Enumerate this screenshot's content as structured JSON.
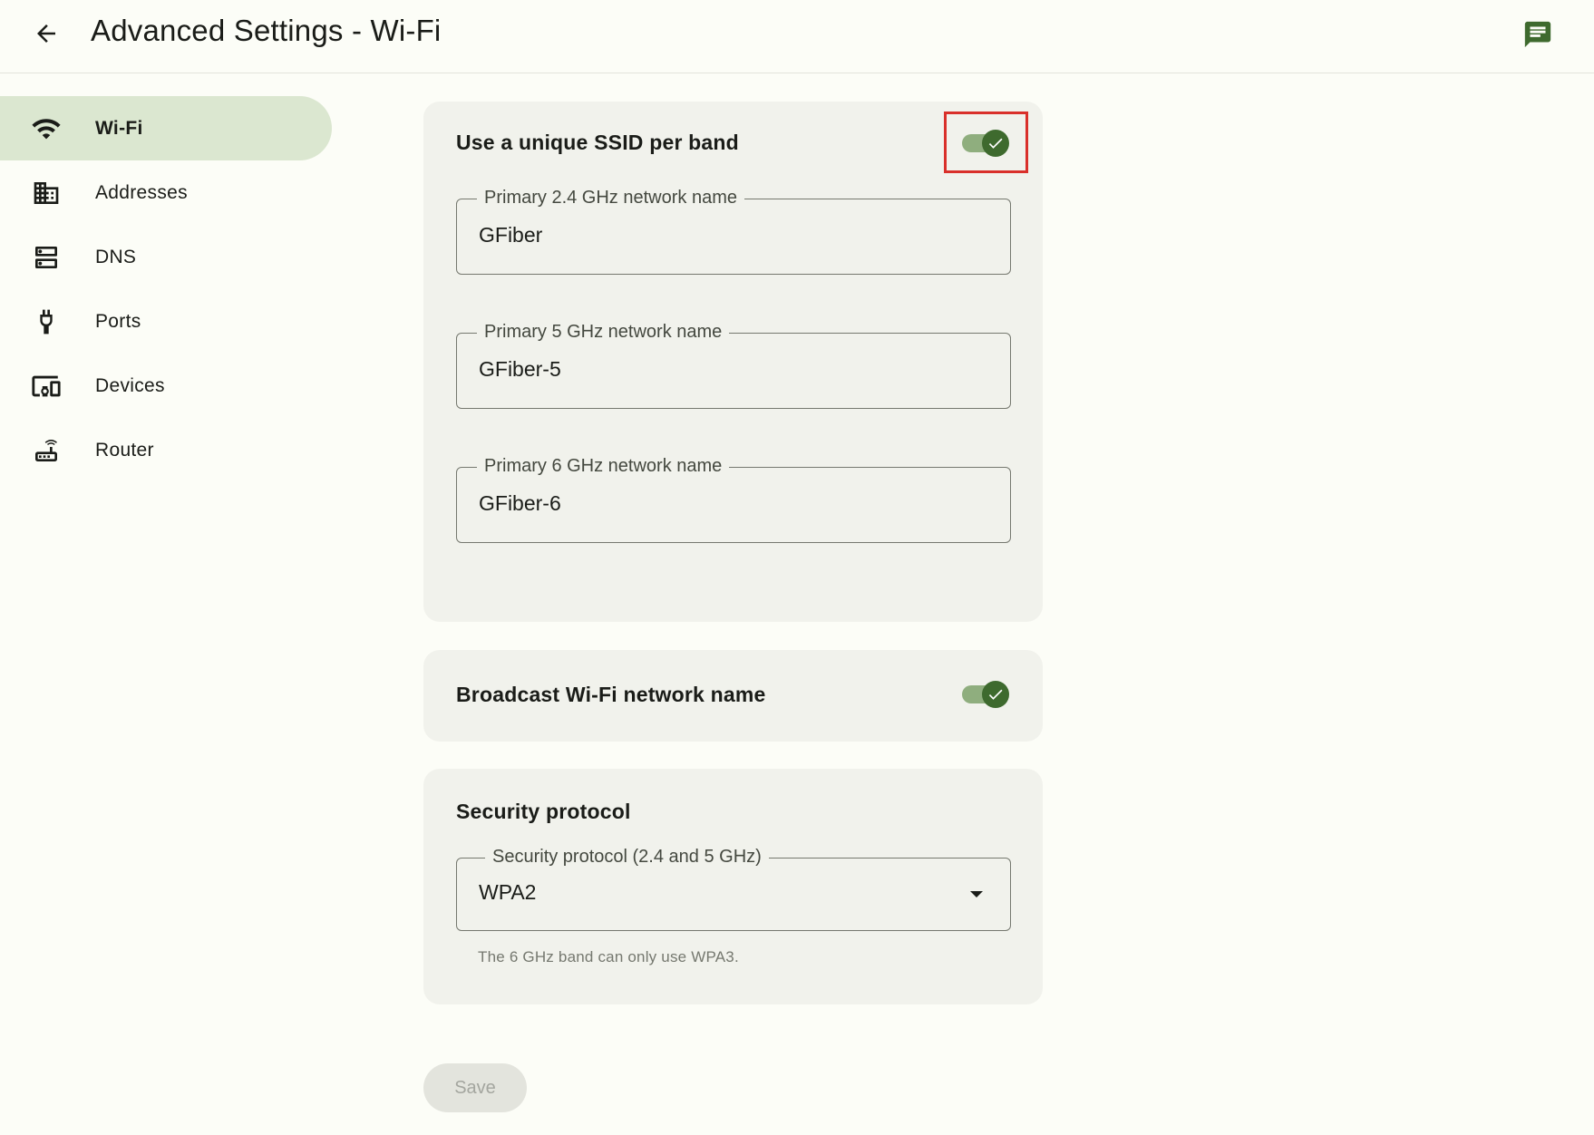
{
  "header": {
    "title": "Advanced Settings - Wi-Fi",
    "back_icon": "arrow-back-icon",
    "feedback_icon": "chat-feedback-icon"
  },
  "sidebar": {
    "items": [
      {
        "label": "Wi-Fi",
        "icon": "wifi-icon",
        "active": true
      },
      {
        "label": "Addresses",
        "icon": "building-icon",
        "active": false
      },
      {
        "label": "DNS",
        "icon": "dns-icon",
        "active": false
      },
      {
        "label": "Ports",
        "icon": "port-plug-icon",
        "active": false
      },
      {
        "label": "Devices",
        "icon": "devices-icon",
        "active": false
      },
      {
        "label": "Router",
        "icon": "router-icon",
        "active": false
      }
    ]
  },
  "ssid_card": {
    "title": "Use a unique SSID per band",
    "toggle_on": true,
    "fields": [
      {
        "label": "Primary 2.4 GHz network name",
        "value": "GFiber"
      },
      {
        "label": "Primary 5 GHz network name",
        "value": "GFiber-5"
      },
      {
        "label": "Primary 6 GHz network name",
        "value": "GFiber-6"
      }
    ]
  },
  "broadcast_card": {
    "title": "Broadcast Wi-Fi network name",
    "toggle_on": true
  },
  "security_card": {
    "title": "Security protocol",
    "select_label": "Security protocol (2.4 and 5 GHz)",
    "select_value": "WPA2",
    "helper_text": "The 6 GHz band can only use WPA3."
  },
  "actions": {
    "save_label": "Save"
  },
  "colors": {
    "background": "#fcfdf7",
    "active_nav": "#dbe7d0",
    "card": "#f1f2ec",
    "toggle_thumb": "#3e6a2e",
    "toggle_track": "#8fae7e",
    "highlight": "#d9302a",
    "feedback_icon": "#3e6a2e"
  }
}
